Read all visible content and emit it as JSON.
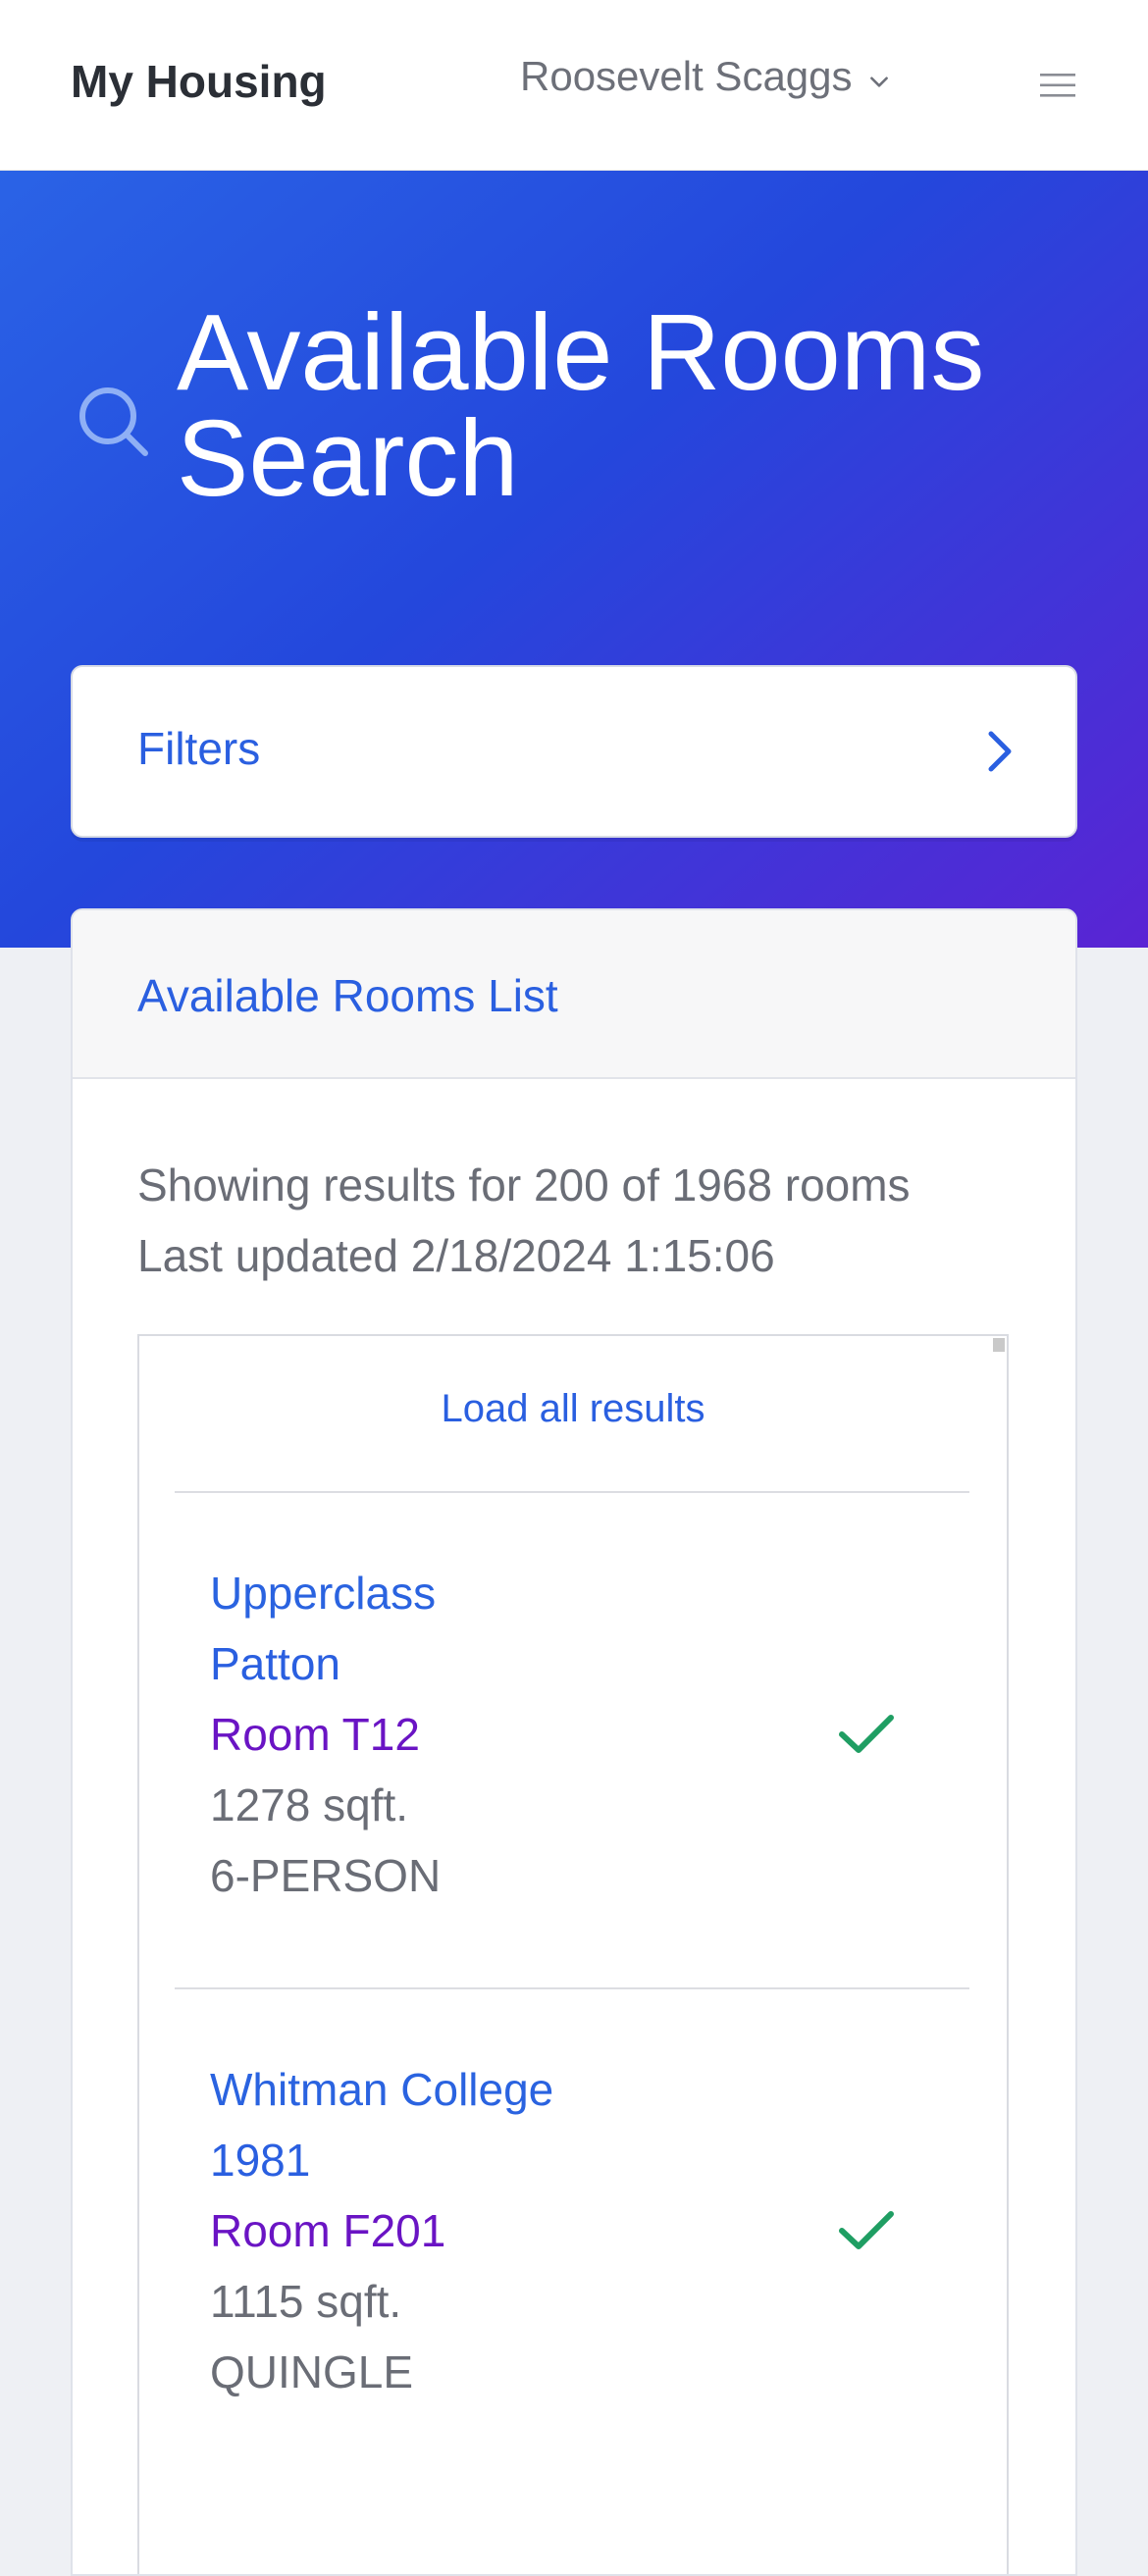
{
  "navbar": {
    "brand": "My Housing",
    "user_name": "Roosevelt Scaggs"
  },
  "hero": {
    "title": "Available Rooms Search"
  },
  "filters": {
    "label": "Filters"
  },
  "list": {
    "title": "Available Rooms List",
    "summary_line1": "Showing results for 200 of 1968 rooms",
    "summary_line2": "Last updated 2/18/2024 1:15:06",
    "load_all_label": "Load all results",
    "rooms": [
      {
        "college": "Upperclass",
        "building": "Patton",
        "room": "Room T12",
        "sqft": "1278 sqft.",
        "type": "6-PERSON",
        "available": true
      },
      {
        "college": "Whitman College",
        "building": "1981",
        "room": "Room F201",
        "sqft": "1115 sqft.",
        "type": "QUINGLE",
        "available": true
      }
    ]
  },
  "colors": {
    "accent": "#2a5fe0",
    "room_number": "#6a14c4",
    "check": "#1f9e63",
    "hero_start": "#2a63e6",
    "hero_end": "#5a24d4"
  }
}
